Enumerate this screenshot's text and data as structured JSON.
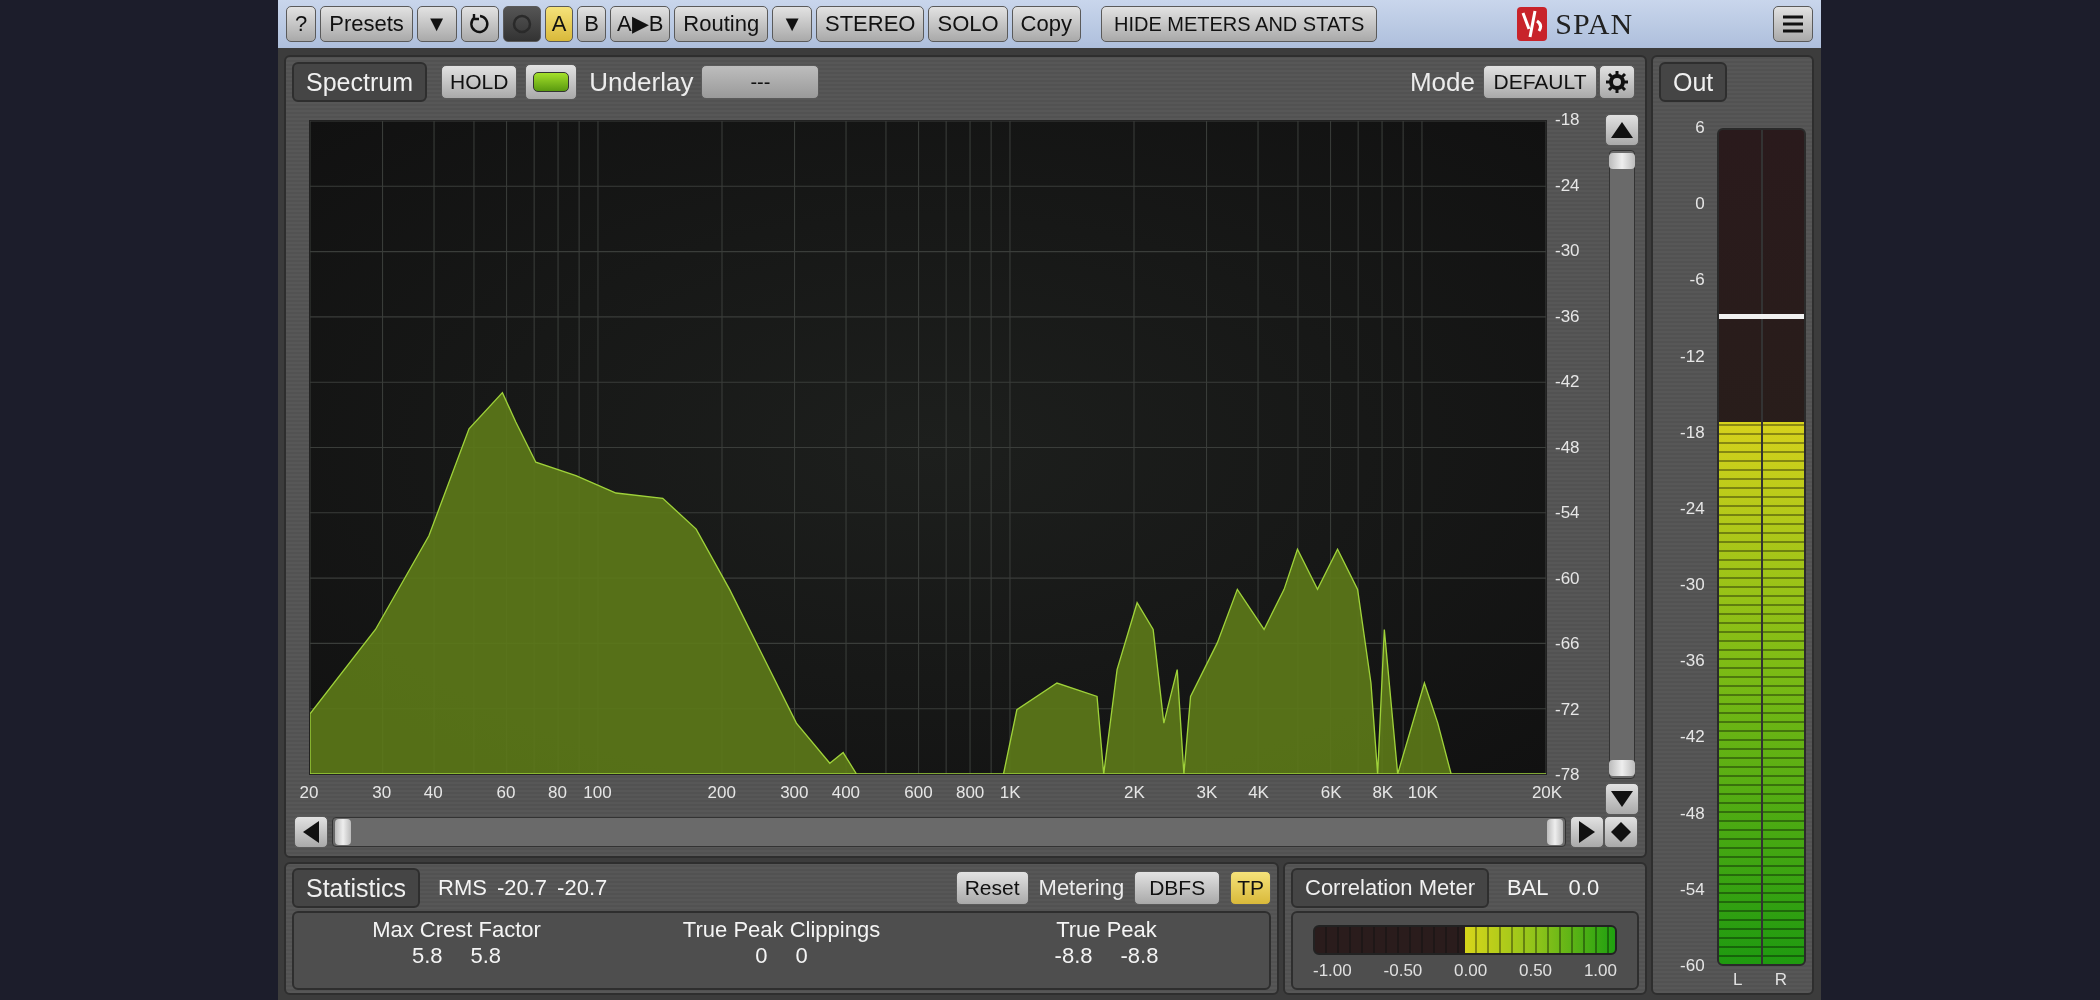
{
  "toolbar": [
    {
      "kind": "button",
      "label": "?"
    },
    {
      "kind": "button",
      "label": "Presets"
    },
    {
      "kind": "button",
      "label": "▼"
    },
    {
      "kind": "undo"
    },
    {
      "kind": "dark"
    },
    {
      "kind": "toggle",
      "label": "A",
      "selected": true
    },
    {
      "kind": "toggle",
      "label": "B",
      "selected": false
    },
    {
      "kind": "toggle",
      "label": "A▶B",
      "selected": false
    },
    {
      "kind": "button",
      "label": "Routing"
    },
    {
      "kind": "button",
      "label": "▼"
    },
    {
      "kind": "button",
      "label": "STEREO"
    },
    {
      "kind": "button",
      "label": "SOLO"
    },
    {
      "kind": "button",
      "label": "Copy"
    },
    {
      "kind": "wide",
      "label": "HIDE METERS AND STATS"
    }
  ],
  "brand": "SPAN",
  "spectrum": {
    "tab": "Spectrum",
    "hold": "HOLD",
    "hold_led": {
      "on": true
    },
    "underlay_label": "Underlay",
    "underlay_value": "---",
    "mode_label": "Mode",
    "mode_value": "DEFAULT",
    "y_ticks": [
      "-18",
      "-24",
      "-30",
      "-36",
      "-42",
      "-48",
      "-54",
      "-60",
      "-66",
      "-72",
      "-78"
    ],
    "x_ticks": [
      "20",
      "30",
      "40",
      "60",
      "80",
      "100",
      "200",
      "300",
      "400",
      "600",
      "800",
      "1K",
      "2K",
      "3K",
      "4K",
      "6K",
      "8K",
      "10K",
      "20K"
    ]
  },
  "statistics": {
    "tab": "Statistics",
    "rms_label": "RMS",
    "rms_values": [
      "-20.7",
      "-20.7"
    ],
    "reset": "Reset",
    "metering_label": "Metering",
    "metering_value": "DBFS",
    "tp": {
      "label": "TP",
      "on": true
    },
    "columns": [
      {
        "title": "Max Crest Factor",
        "values": [
          "5.8",
          "5.8"
        ]
      },
      {
        "title": "True Peak Clippings",
        "values": [
          "0",
          "0"
        ]
      },
      {
        "title": "True Peak",
        "values": [
          "-8.8",
          "-8.8"
        ]
      }
    ]
  },
  "correlation": {
    "tab": "Correlation Meter",
    "bal_label": "BAL",
    "bal_value": "0.0",
    "level": 1,
    "ticks": [
      "-1.00",
      "-0.50",
      "0.00",
      "0.50",
      "1.00"
    ]
  },
  "out": {
    "tab": "Out",
    "ticks": [
      "6",
      "0",
      "-6",
      "-12",
      "-18",
      "-24",
      "-30",
      "-36",
      "-42",
      "-48",
      "-54",
      "-60"
    ],
    "level": 0.65,
    "peak_hold": {
      "level": 0.773
    },
    "channels": [
      "L",
      "R"
    ]
  }
}
